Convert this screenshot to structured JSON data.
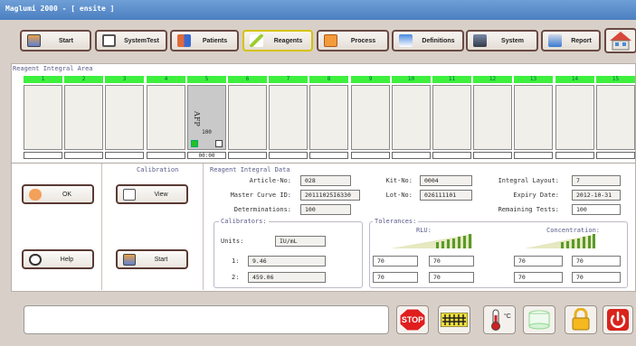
{
  "window": {
    "title": "Maglumi 2000 - [ ensite ]"
  },
  "toolbar": {
    "buttons": [
      {
        "label": "Start",
        "icon": "start-icon"
      },
      {
        "label": "SystemTest",
        "icon": "system-test-icon"
      },
      {
        "label": "Patients",
        "icon": "patients-icon"
      },
      {
        "label": "Reagents",
        "icon": "reagents-icon",
        "active": true
      },
      {
        "label": "Process",
        "icon": "process-icon"
      },
      {
        "label": "Definitions",
        "icon": "definitions-icon"
      },
      {
        "label": "System",
        "icon": "system-icon"
      },
      {
        "label": "Report",
        "icon": "report-icon"
      }
    ],
    "home_icon": "home-icon"
  },
  "reagent_area": {
    "title": "Reagent Integral Area",
    "slots": [
      {
        "num": "1",
        "name": "",
        "value": "",
        "box": ""
      },
      {
        "num": "2",
        "name": "",
        "value": "",
        "box": ""
      },
      {
        "num": "3",
        "name": "",
        "value": "",
        "box": ""
      },
      {
        "num": "4",
        "name": "",
        "value": "",
        "box": ""
      },
      {
        "num": "5",
        "name": "AFP",
        "value": "100",
        "box": "00:00"
      },
      {
        "num": "6",
        "name": "",
        "value": "",
        "box": ""
      },
      {
        "num": "7",
        "name": "",
        "value": "",
        "box": ""
      },
      {
        "num": "8",
        "name": "",
        "value": "",
        "box": ""
      },
      {
        "num": "9",
        "name": "",
        "value": "",
        "box": ""
      },
      {
        "num": "10",
        "name": "",
        "value": "",
        "box": ""
      },
      {
        "num": "11",
        "name": "",
        "value": "",
        "box": ""
      },
      {
        "num": "12",
        "name": "",
        "value": "",
        "box": ""
      },
      {
        "num": "13",
        "name": "",
        "value": "",
        "box": ""
      },
      {
        "num": "14",
        "name": "",
        "value": "",
        "box": ""
      },
      {
        "num": "15",
        "name": "",
        "value": "",
        "box": ""
      }
    ]
  },
  "left_buttons": {
    "ok": "OK",
    "help": "Help"
  },
  "calibration": {
    "title": "Calibration",
    "view": "View",
    "start": "Start"
  },
  "integral_data": {
    "title": "Reagent Integral Data",
    "article_no": {
      "label": "Article-No:",
      "value": "028"
    },
    "master_curve": {
      "label": "Master Curve ID:",
      "value": "20111025I6330"
    },
    "determinations": {
      "label": "Determinations:",
      "value": "100"
    },
    "kit_no": {
      "label": "Kit-No:",
      "value": "0004"
    },
    "lot_no": {
      "label": "Lot-No:",
      "value": "026111101"
    },
    "layout": {
      "label": "Integral Layout:",
      "value": "7"
    },
    "expiry": {
      "label": "Expiry Date:",
      "value": "2012-10-31"
    },
    "remaining": {
      "label": "Remaining Tests:",
      "value": "100"
    }
  },
  "calibrators": {
    "title": "Calibrators:",
    "units_label": "Units:",
    "units": "IU/mL",
    "rows": [
      {
        "label": "1:",
        "value": "9.46"
      },
      {
        "label": "2:",
        "value": "459.06"
      }
    ]
  },
  "tolerances": {
    "title": "Tolerances:",
    "rlu": "RLU:",
    "conc": "Concentration:",
    "rlu_values": [
      [
        "70",
        "70"
      ],
      [
        "70",
        "70"
      ]
    ],
    "conc_values": [
      [
        "70",
        "70"
      ],
      [
        "70",
        "70"
      ]
    ]
  },
  "bottom": {
    "message": "",
    "stop_label": "STOP",
    "temp_label": "°C"
  }
}
